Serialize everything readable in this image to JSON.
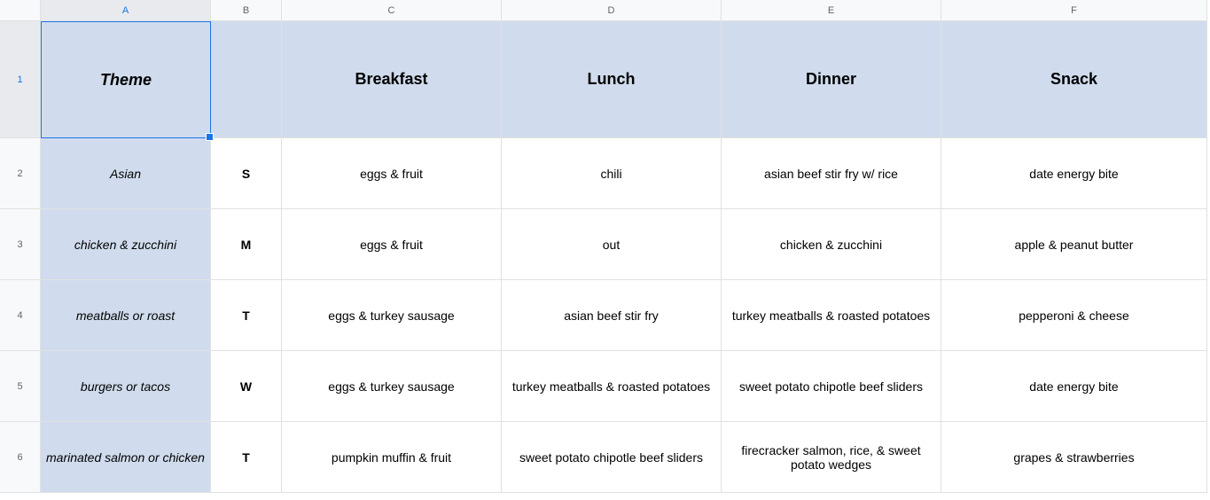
{
  "columns": [
    "A",
    "B",
    "C",
    "D",
    "E",
    "F"
  ],
  "rowNumbers": [
    "1",
    "2",
    "3",
    "4",
    "5",
    "6"
  ],
  "headers": {
    "theme": "Theme",
    "day": "",
    "breakfast": "Breakfast",
    "lunch": "Lunch",
    "dinner": "Dinner",
    "snack": "Snack"
  },
  "rows": [
    {
      "theme": "Asian",
      "day": "S",
      "breakfast": "eggs & fruit",
      "lunch": "chili",
      "dinner": "asian beef stir fry w/ rice",
      "snack": "date energy bite"
    },
    {
      "theme": "chicken & zucchini",
      "day": "M",
      "breakfast": "eggs & fruit",
      "lunch": "out",
      "dinner": "chicken & zucchini",
      "snack": "apple & peanut butter"
    },
    {
      "theme": "meatballs or roast",
      "day": "T",
      "breakfast": "eggs & turkey sausage",
      "lunch": "asian beef stir fry",
      "dinner": "turkey meatballs & roasted potatoes",
      "snack": "pepperoni & cheese"
    },
    {
      "theme": "burgers or tacos",
      "day": "W",
      "breakfast": "eggs & turkey sausage",
      "lunch": "turkey meatballs & roasted potatoes",
      "dinner": "sweet potato chipotle beef sliders",
      "snack": "date energy bite"
    },
    {
      "theme": "marinated salmon or chicken",
      "day": "T",
      "breakfast": "pumpkin muffin & fruit",
      "lunch": "sweet potato chipotle beef sliders",
      "dinner": "firecracker salmon, rice, & sweet potato wedges",
      "snack": "grapes & strawberries"
    }
  ],
  "selected": {
    "col": "A",
    "row": "1"
  }
}
